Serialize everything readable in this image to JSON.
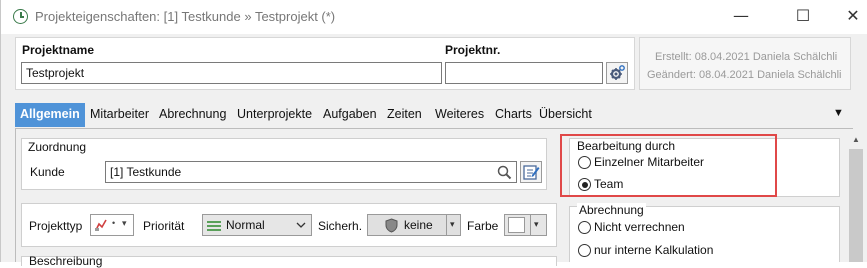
{
  "window": {
    "title": "Projekteigenschaften: [1] Testkunde » Testprojekt (*)",
    "minimize_glyph": "—",
    "maximize_glyph": "☐",
    "close_glyph": "✕"
  },
  "header": {
    "projektname_label": "Projektname",
    "projektname_value": "Testprojekt",
    "projektnr_label": "Projektnr.",
    "projektnr_value": "",
    "created": "Erstellt: 08.04.2021 Daniela Schälchli",
    "changed": "Geändert: 08.04.2021 Daniela Schälchli"
  },
  "tabs": [
    "Allgemein",
    "Mitarbeiter",
    "Abrechnung",
    "Unterprojekte",
    "Aufgaben",
    "Zeiten",
    "Weiteres",
    "Charts",
    "Übersicht"
  ],
  "tabs_more_glyph": "▼",
  "zuordnung": {
    "title": "Zuordnung",
    "kunde_label": "Kunde",
    "kunde_value": "[1] Testkunde"
  },
  "bearbeitung": {
    "title": "Bearbeitung durch",
    "options": [
      "Einzelner Mitarbeiter",
      "Team"
    ],
    "selected": "Team"
  },
  "abrechnung": {
    "title": "Abrechnung",
    "options": [
      "Nicht verrechnen",
      "nur interne Kalkulation"
    ],
    "selected": ""
  },
  "attributes": {
    "projekttyp_label": "Projekttyp",
    "prioritaet_label": "Priorität",
    "prioritaet_value": "Normal",
    "sicherh_label": "Sicherh.",
    "sicherh_value": "keine",
    "farbe_label": "Farbe"
  },
  "beschreibung": {
    "title": "Beschreibung"
  },
  "colors": {
    "tab_active": "#4f93d8",
    "highlight_border": "#e04848",
    "priority_icon": "#5aa05a"
  }
}
